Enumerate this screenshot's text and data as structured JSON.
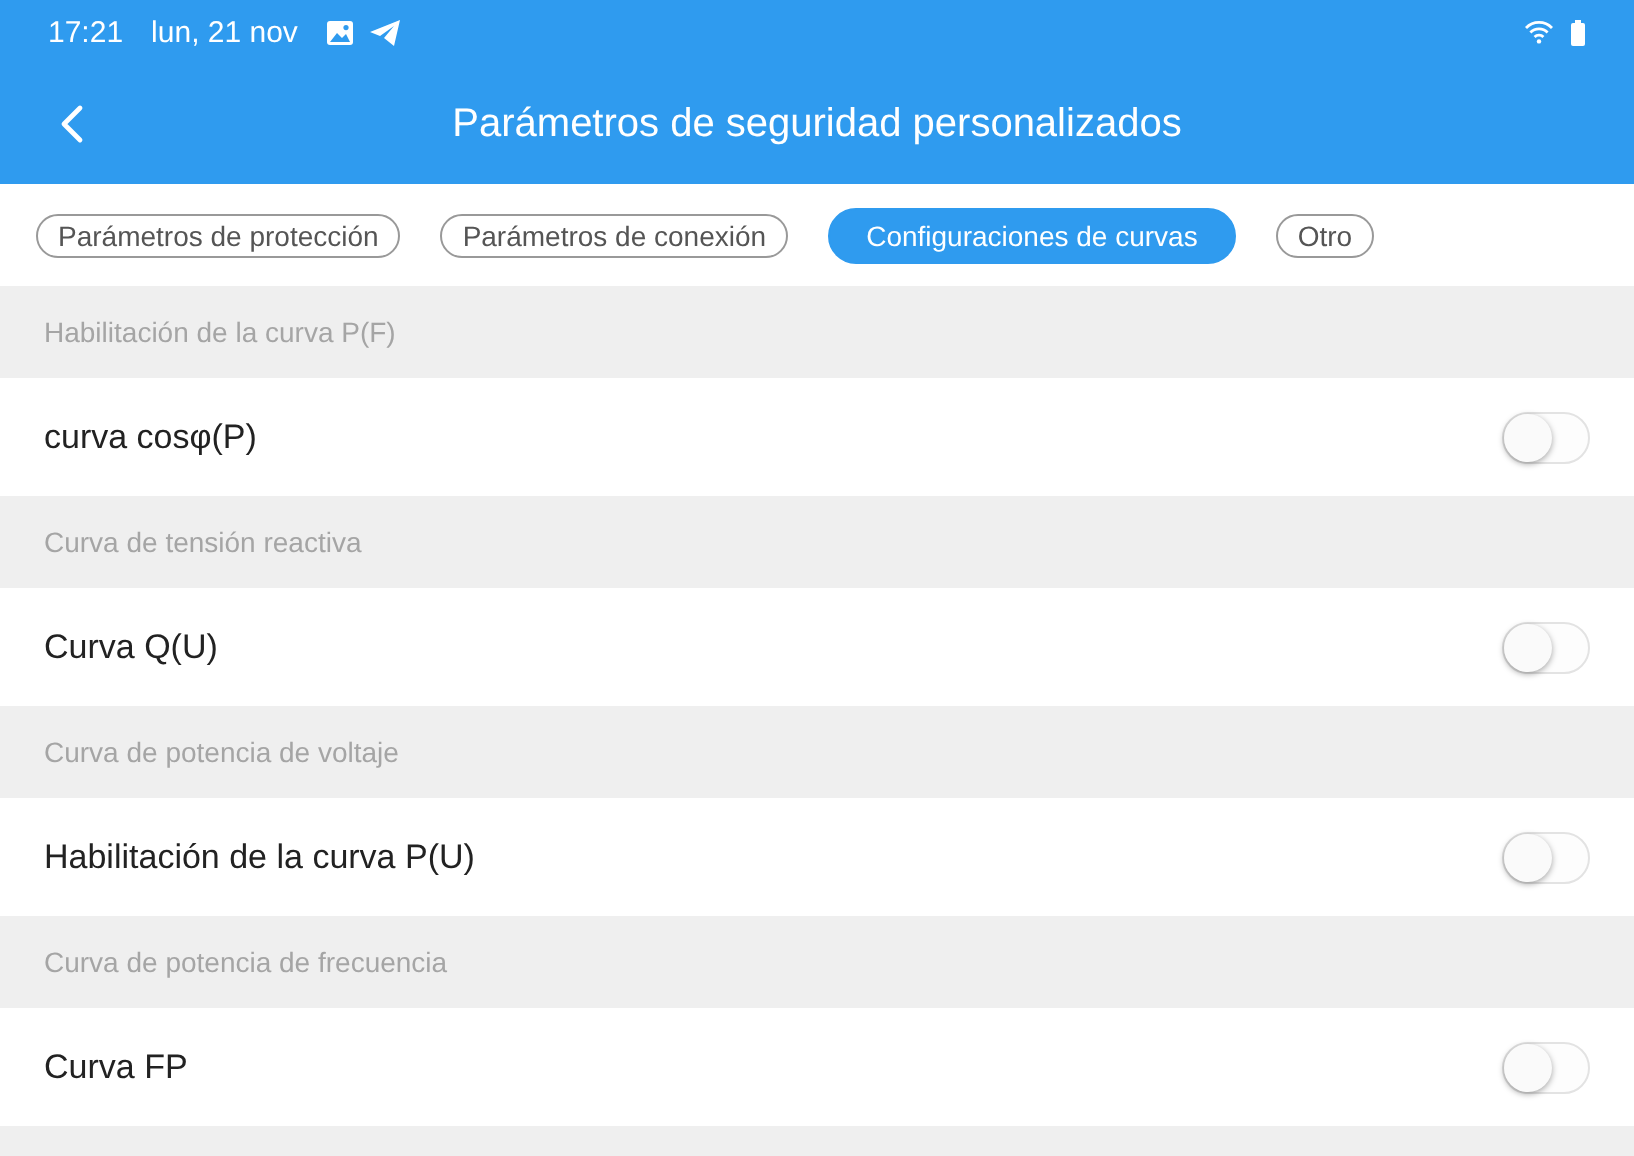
{
  "status_bar": {
    "time": "17:21",
    "date": "lun, 21 nov"
  },
  "header": {
    "title": "Parámetros de seguridad personalizados"
  },
  "tabs": [
    {
      "label": "Parámetros de protección",
      "selected": false
    },
    {
      "label": "Parámetros de conexión",
      "selected": false
    },
    {
      "label": "Configuraciones de curvas",
      "selected": true
    },
    {
      "label": "Otro",
      "selected": false
    }
  ],
  "sections": [
    {
      "heading": "Habilitación de la curva P(F)",
      "label": "curva cosφ(P)",
      "on": false
    },
    {
      "heading": "Curva de tensión reactiva",
      "label": "Curva Q(U)",
      "on": false
    },
    {
      "heading": "Curva de potencia de voltaje",
      "label": "Habilitación de la curva P(U)",
      "on": false
    },
    {
      "heading": "Curva de potencia de frecuencia",
      "label": "Curva FP",
      "on": false
    }
  ]
}
